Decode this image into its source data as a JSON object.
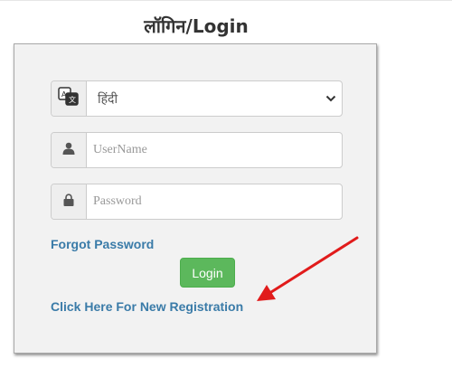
{
  "header": {
    "title": "लॉगिन/Login"
  },
  "form": {
    "language": {
      "selected": "हिंदी",
      "icon": "language-icon"
    },
    "username": {
      "placeholder": "UserName",
      "icon": "user-icon"
    },
    "password": {
      "placeholder": "Password",
      "icon": "lock-icon"
    },
    "forgot_password": "Forgot Password",
    "login_button": "Login",
    "registration_link": "Click Here For New Registration"
  },
  "colors": {
    "link": "#3a7ba8",
    "button": "#5cb85c",
    "annotation_arrow": "#e11b1b",
    "panel_bg": "#f2f2f2"
  }
}
